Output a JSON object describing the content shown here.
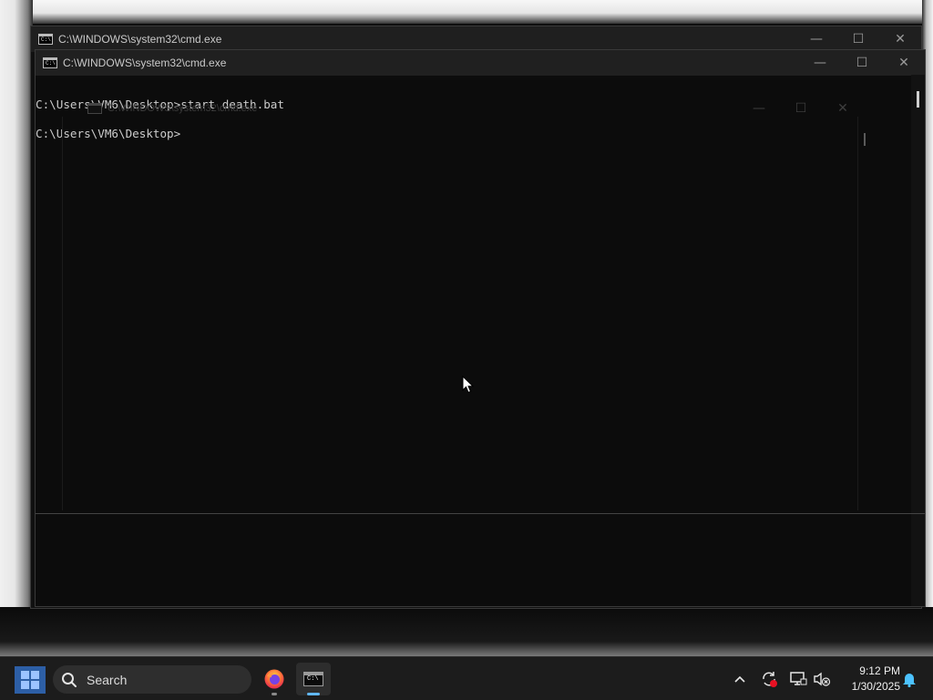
{
  "windows": {
    "back": {
      "title": "C:\\WINDOWS\\system32\\cmd.exe"
    },
    "front": {
      "title": "C:\\WINDOWS\\system32\\cmd.exe",
      "console_lines": [
        "C:\\Users\\VM6\\Desktop>start death.bat",
        "C:\\Users\\VM6\\Desktop>"
      ]
    },
    "ghost": {
      "title": "C:\\WINDOWS\\system32\\cmd.exe"
    },
    "caption_buttons": {
      "minimize": "—",
      "maximize": "☐",
      "close": "✕"
    },
    "icon_text": "C:\\"
  },
  "taskbar": {
    "search_label": "Search",
    "apps": [
      {
        "name": "Firefox",
        "icon": "firefox-icon"
      },
      {
        "name": "Command Prompt",
        "icon": "cmd-icon",
        "active": true
      }
    ],
    "tray": {
      "overflow": "chevron-up-icon",
      "icons": [
        "sync-error-icon",
        "network-icon",
        "volume-muted-icon"
      ],
      "time": "9:12 PM",
      "date": "1/30/2025",
      "notifications": "bell-icon"
    }
  },
  "colors": {
    "console_text": "#cccccc",
    "console_bg": "#0c0c0c",
    "taskbar_bg": "#1c1c1c",
    "accent": "#60b7f4"
  }
}
